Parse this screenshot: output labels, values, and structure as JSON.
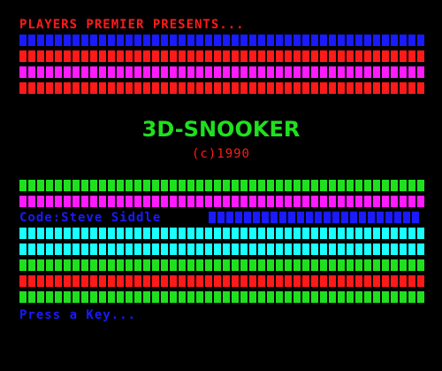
{
  "header": {
    "presents": "PLAYERS PREMIER PRESENTS...",
    "color": "#ff1a1a"
  },
  "title": {
    "text": "3D-SNOOKER",
    "color": "#1fe01f"
  },
  "copyright": {
    "text": "(c)1990",
    "color": "#ff1a1a"
  },
  "credit": {
    "text": "Code:Steve Siddle",
    "color": "#1a1aff"
  },
  "prompt": {
    "text": "Press a Key...",
    "color": "#1a1aff"
  },
  "top_bars": [
    "#1a1aff",
    "#ff1a1a",
    "#ff1aff",
    "#ff1a1a"
  ],
  "bottom_bars": [
    "#1fe01f",
    "#ff1aff",
    "#1a1aff",
    "#1affff",
    "#1affff",
    "#1fe01f",
    "#ff1a1a",
    "#1fe01f"
  ]
}
